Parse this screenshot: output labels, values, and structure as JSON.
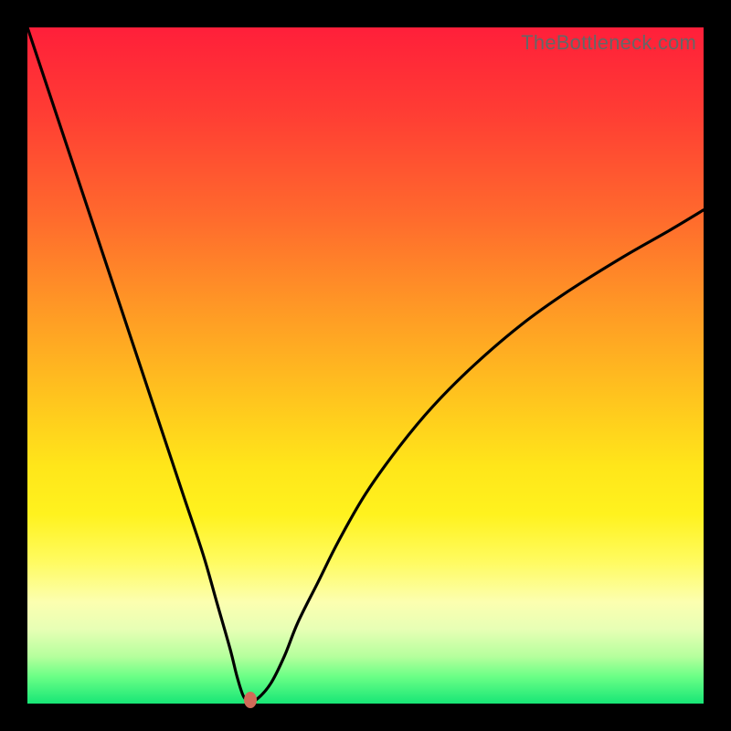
{
  "watermark": "TheBottleneck.com",
  "colors": {
    "frame": "#000000",
    "curve": "#000000",
    "marker": "#d06a58"
  },
  "chart_data": {
    "type": "line",
    "title": "",
    "xlabel": "",
    "ylabel": "",
    "xlim": [
      0,
      100
    ],
    "ylim": [
      0,
      100
    ],
    "grid": false,
    "legend": false,
    "series": [
      {
        "name": "bottleneck-curve",
        "x": [
          0,
          2,
          5,
          8,
          11,
          14,
          17,
          20,
          23,
          26,
          28,
          30,
          31,
          32,
          33,
          34,
          36,
          38,
          40,
          43,
          46,
          50,
          55,
          60,
          66,
          73,
          80,
          88,
          95,
          100
        ],
        "y": [
          100,
          94,
          85,
          76,
          67,
          58,
          49,
          40,
          31,
          22,
          15,
          8,
          4,
          1,
          0.5,
          0.7,
          3,
          7,
          12,
          18,
          24,
          31,
          38,
          44,
          50,
          56,
          61,
          66,
          70,
          73
        ]
      }
    ],
    "annotations": [
      {
        "name": "min-marker",
        "x": 33,
        "y": 0.5
      }
    ],
    "gradient_stops": [
      {
        "pos": 0.0,
        "color": "#ff1f3a"
      },
      {
        "pos": 0.12,
        "color": "#ff3b34"
      },
      {
        "pos": 0.28,
        "color": "#ff6a2d"
      },
      {
        "pos": 0.42,
        "color": "#ff9a25"
      },
      {
        "pos": 0.55,
        "color": "#ffc51e"
      },
      {
        "pos": 0.65,
        "color": "#ffe61a"
      },
      {
        "pos": 0.72,
        "color": "#fff21e"
      },
      {
        "pos": 0.79,
        "color": "#fffb60"
      },
      {
        "pos": 0.85,
        "color": "#fcffb0"
      },
      {
        "pos": 0.89,
        "color": "#e7ffb5"
      },
      {
        "pos": 0.93,
        "color": "#b6ff9d"
      },
      {
        "pos": 0.96,
        "color": "#6bff86"
      },
      {
        "pos": 1.0,
        "color": "#17e676"
      }
    ]
  }
}
